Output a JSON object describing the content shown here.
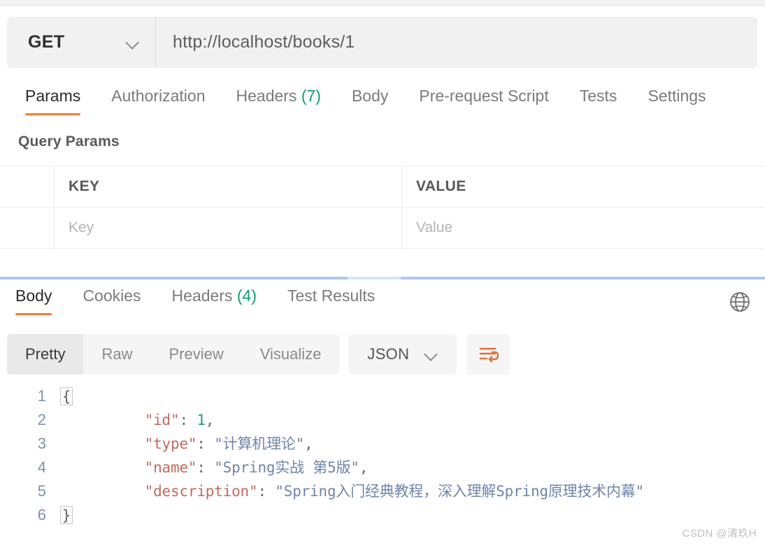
{
  "request": {
    "method": "GET",
    "method_icon": "chevron-down-icon",
    "url": "http://localhost/books/1",
    "url_placeholder": "Enter request URL",
    "tabs": [
      {
        "label": "Params",
        "active": true
      },
      {
        "label": "Authorization",
        "active": false
      },
      {
        "label": "Headers",
        "count": "(7)",
        "active": false
      },
      {
        "label": "Body",
        "active": false
      },
      {
        "label": "Pre-request Script",
        "active": false
      },
      {
        "label": "Tests",
        "active": false
      },
      {
        "label": "Settings",
        "active": false
      }
    ],
    "query_params": {
      "title": "Query Params",
      "columns": [
        "KEY",
        "VALUE"
      ],
      "rows": [
        {
          "key_placeholder": "Key",
          "value_placeholder": "Value"
        }
      ]
    }
  },
  "response": {
    "tabs": [
      {
        "label": "Body",
        "active": true
      },
      {
        "label": "Cookies",
        "active": false
      },
      {
        "label": "Headers",
        "count": "(4)",
        "active": false
      },
      {
        "label": "Test Results",
        "active": false
      }
    ],
    "globe_icon": "globe-icon",
    "format_views": [
      {
        "label": "Pretty",
        "active": true
      },
      {
        "label": "Raw",
        "active": false
      },
      {
        "label": "Preview",
        "active": false
      },
      {
        "label": "Visualize",
        "active": false
      }
    ],
    "language": "JSON",
    "language_icon": "chevron-down-icon",
    "wrap_icon": "word-wrap-icon",
    "body_lines": [
      {
        "number": "1",
        "fold": "{",
        "tokens": []
      },
      {
        "number": "2",
        "fold": "",
        "tokens": [
          {
            "t": "\"id\"",
            "c": "tk-key"
          },
          {
            "t": ": ",
            "c": "tk-pun"
          },
          {
            "t": "1",
            "c": "tk-num"
          },
          {
            "t": ",",
            "c": "tk-pun"
          }
        ]
      },
      {
        "number": "3",
        "fold": "",
        "tokens": [
          {
            "t": "\"type\"",
            "c": "tk-key"
          },
          {
            "t": ": ",
            "c": "tk-pun"
          },
          {
            "t": "\"计算机理论\"",
            "c": "tk-str"
          },
          {
            "t": ",",
            "c": "tk-pun"
          }
        ]
      },
      {
        "number": "4",
        "fold": "",
        "tokens": [
          {
            "t": "\"name\"",
            "c": "tk-key"
          },
          {
            "t": ": ",
            "c": "tk-pun"
          },
          {
            "t": "\"Spring实战 第5版\"",
            "c": "tk-str"
          },
          {
            "t": ",",
            "c": "tk-pun"
          }
        ]
      },
      {
        "number": "5",
        "fold": "",
        "tokens": [
          {
            "t": "\"description\"",
            "c": "tk-key"
          },
          {
            "t": ": ",
            "c": "tk-pun"
          },
          {
            "t": "\"Spring入门经典教程，深入理解Spring原理技术内幕\"",
            "c": "tk-str"
          }
        ]
      },
      {
        "number": "6",
        "fold": "}",
        "tokens": []
      }
    ]
  },
  "watermark": "CSDN @清玖H",
  "colors": {
    "accent": "#ff7a33",
    "count_badge": "#0f9e6f",
    "divider": "#a9cbea",
    "json_key": "#c4695f",
    "json_string": "#6f85a8",
    "json_number": "#1f9d8a"
  }
}
